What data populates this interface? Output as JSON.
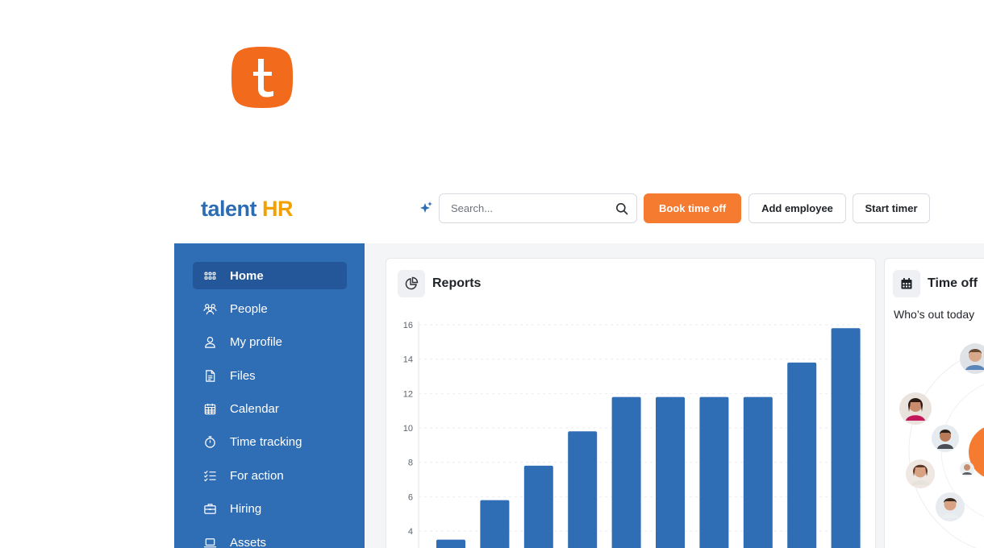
{
  "brand": {
    "logo_talent": "talent",
    "logo_hr": "HR"
  },
  "search": {
    "placeholder": "Search..."
  },
  "header_actions": {
    "book_time_off": "Book time off",
    "add_employee": "Add employee",
    "start_timer": "Start timer"
  },
  "sidebar": {
    "items": [
      {
        "label": "Home",
        "icon": "grid-icon",
        "active": true
      },
      {
        "label": "People",
        "icon": "people-icon",
        "active": false
      },
      {
        "label": "My profile",
        "icon": "user-icon",
        "active": false
      },
      {
        "label": "Files",
        "icon": "file-icon",
        "active": false
      },
      {
        "label": "Calendar",
        "icon": "calendar-icon",
        "active": false
      },
      {
        "label": "Time tracking",
        "icon": "stopwatch-icon",
        "active": false
      },
      {
        "label": "For action",
        "icon": "checklist-icon",
        "active": false
      },
      {
        "label": "Hiring",
        "icon": "briefcase-icon",
        "active": false
      },
      {
        "label": "Assets",
        "icon": "laptop-icon",
        "active": false
      }
    ]
  },
  "reports": {
    "title": "Reports",
    "chart_data": {
      "type": "bar",
      "values": [
        3.5,
        5.8,
        7.8,
        9.8,
        11.8,
        11.8,
        11.8,
        11.8,
        13.8,
        15.8
      ],
      "yticks": [
        4,
        6,
        8,
        10,
        12,
        14,
        16
      ],
      "ylim": [
        3,
        16
      ],
      "grid": true,
      "bar_color": "#2f6db5"
    }
  },
  "time_off": {
    "title": "Time off",
    "subtitle": "Who’s out today"
  },
  "colors": {
    "accent": "#f47b30",
    "sidebar_bg": "#2f6db5",
    "brand_blue": "#2d6cb3",
    "brand_orange": "#f2a100"
  }
}
